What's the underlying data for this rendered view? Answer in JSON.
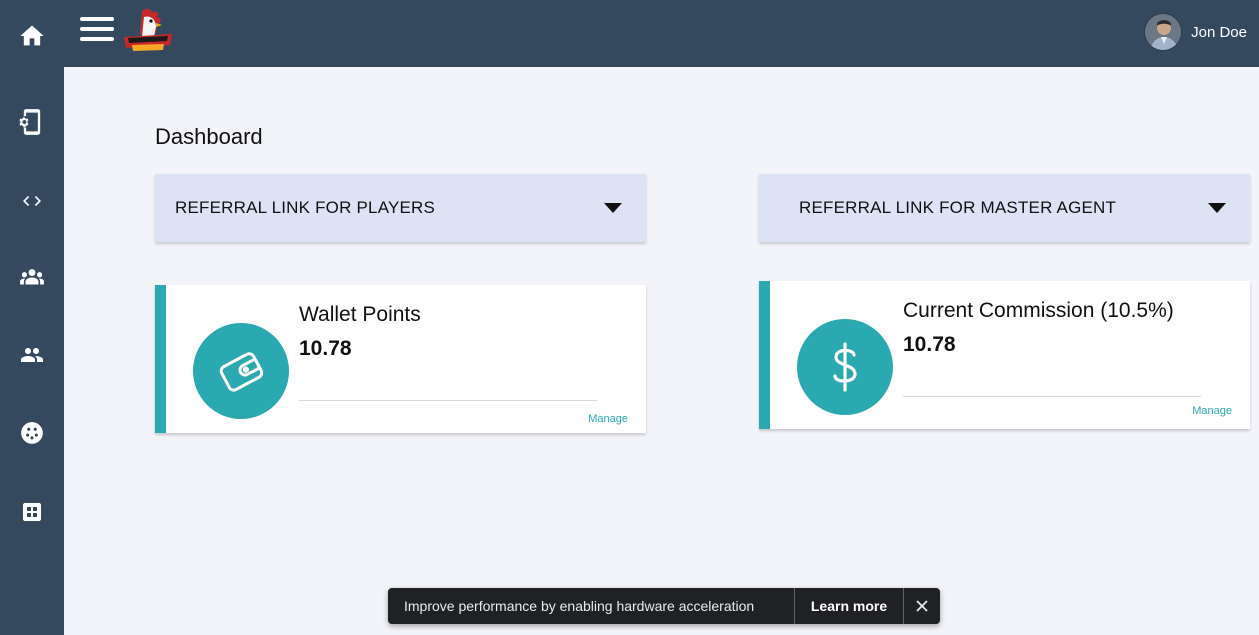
{
  "header": {
    "user_name": "Jon Doe"
  },
  "sidebar": {
    "items": [
      {
        "icon": "home-icon"
      },
      {
        "icon": "mobile-settings-icon"
      },
      {
        "icon": "code-icon"
      },
      {
        "icon": "group-icon"
      },
      {
        "icon": "people-icon"
      },
      {
        "icon": "sports-icon"
      },
      {
        "icon": "grid-icon"
      }
    ]
  },
  "main": {
    "title": "Dashboard",
    "referral_players": "REFERRAL LINK FOR PLAYERS",
    "referral_master": "REFERRAL LINK FOR MASTER AGENT",
    "cards": [
      {
        "title": "Wallet Points",
        "value": "10.78",
        "link": "Manage",
        "icon": "wallet-icon"
      },
      {
        "title": "Current Commission (10.5%)",
        "value": "10.78",
        "link": "Manage",
        "icon": "dollar-icon"
      }
    ]
  },
  "toast": {
    "message": "Improve performance by enabling hardware acceleration",
    "action": "Learn more"
  },
  "colors": {
    "nav_bg": "#34495e",
    "accent": "#2aa9b0",
    "panel_bg": "#dde2f4",
    "page_bg": "#f3f4f9"
  }
}
